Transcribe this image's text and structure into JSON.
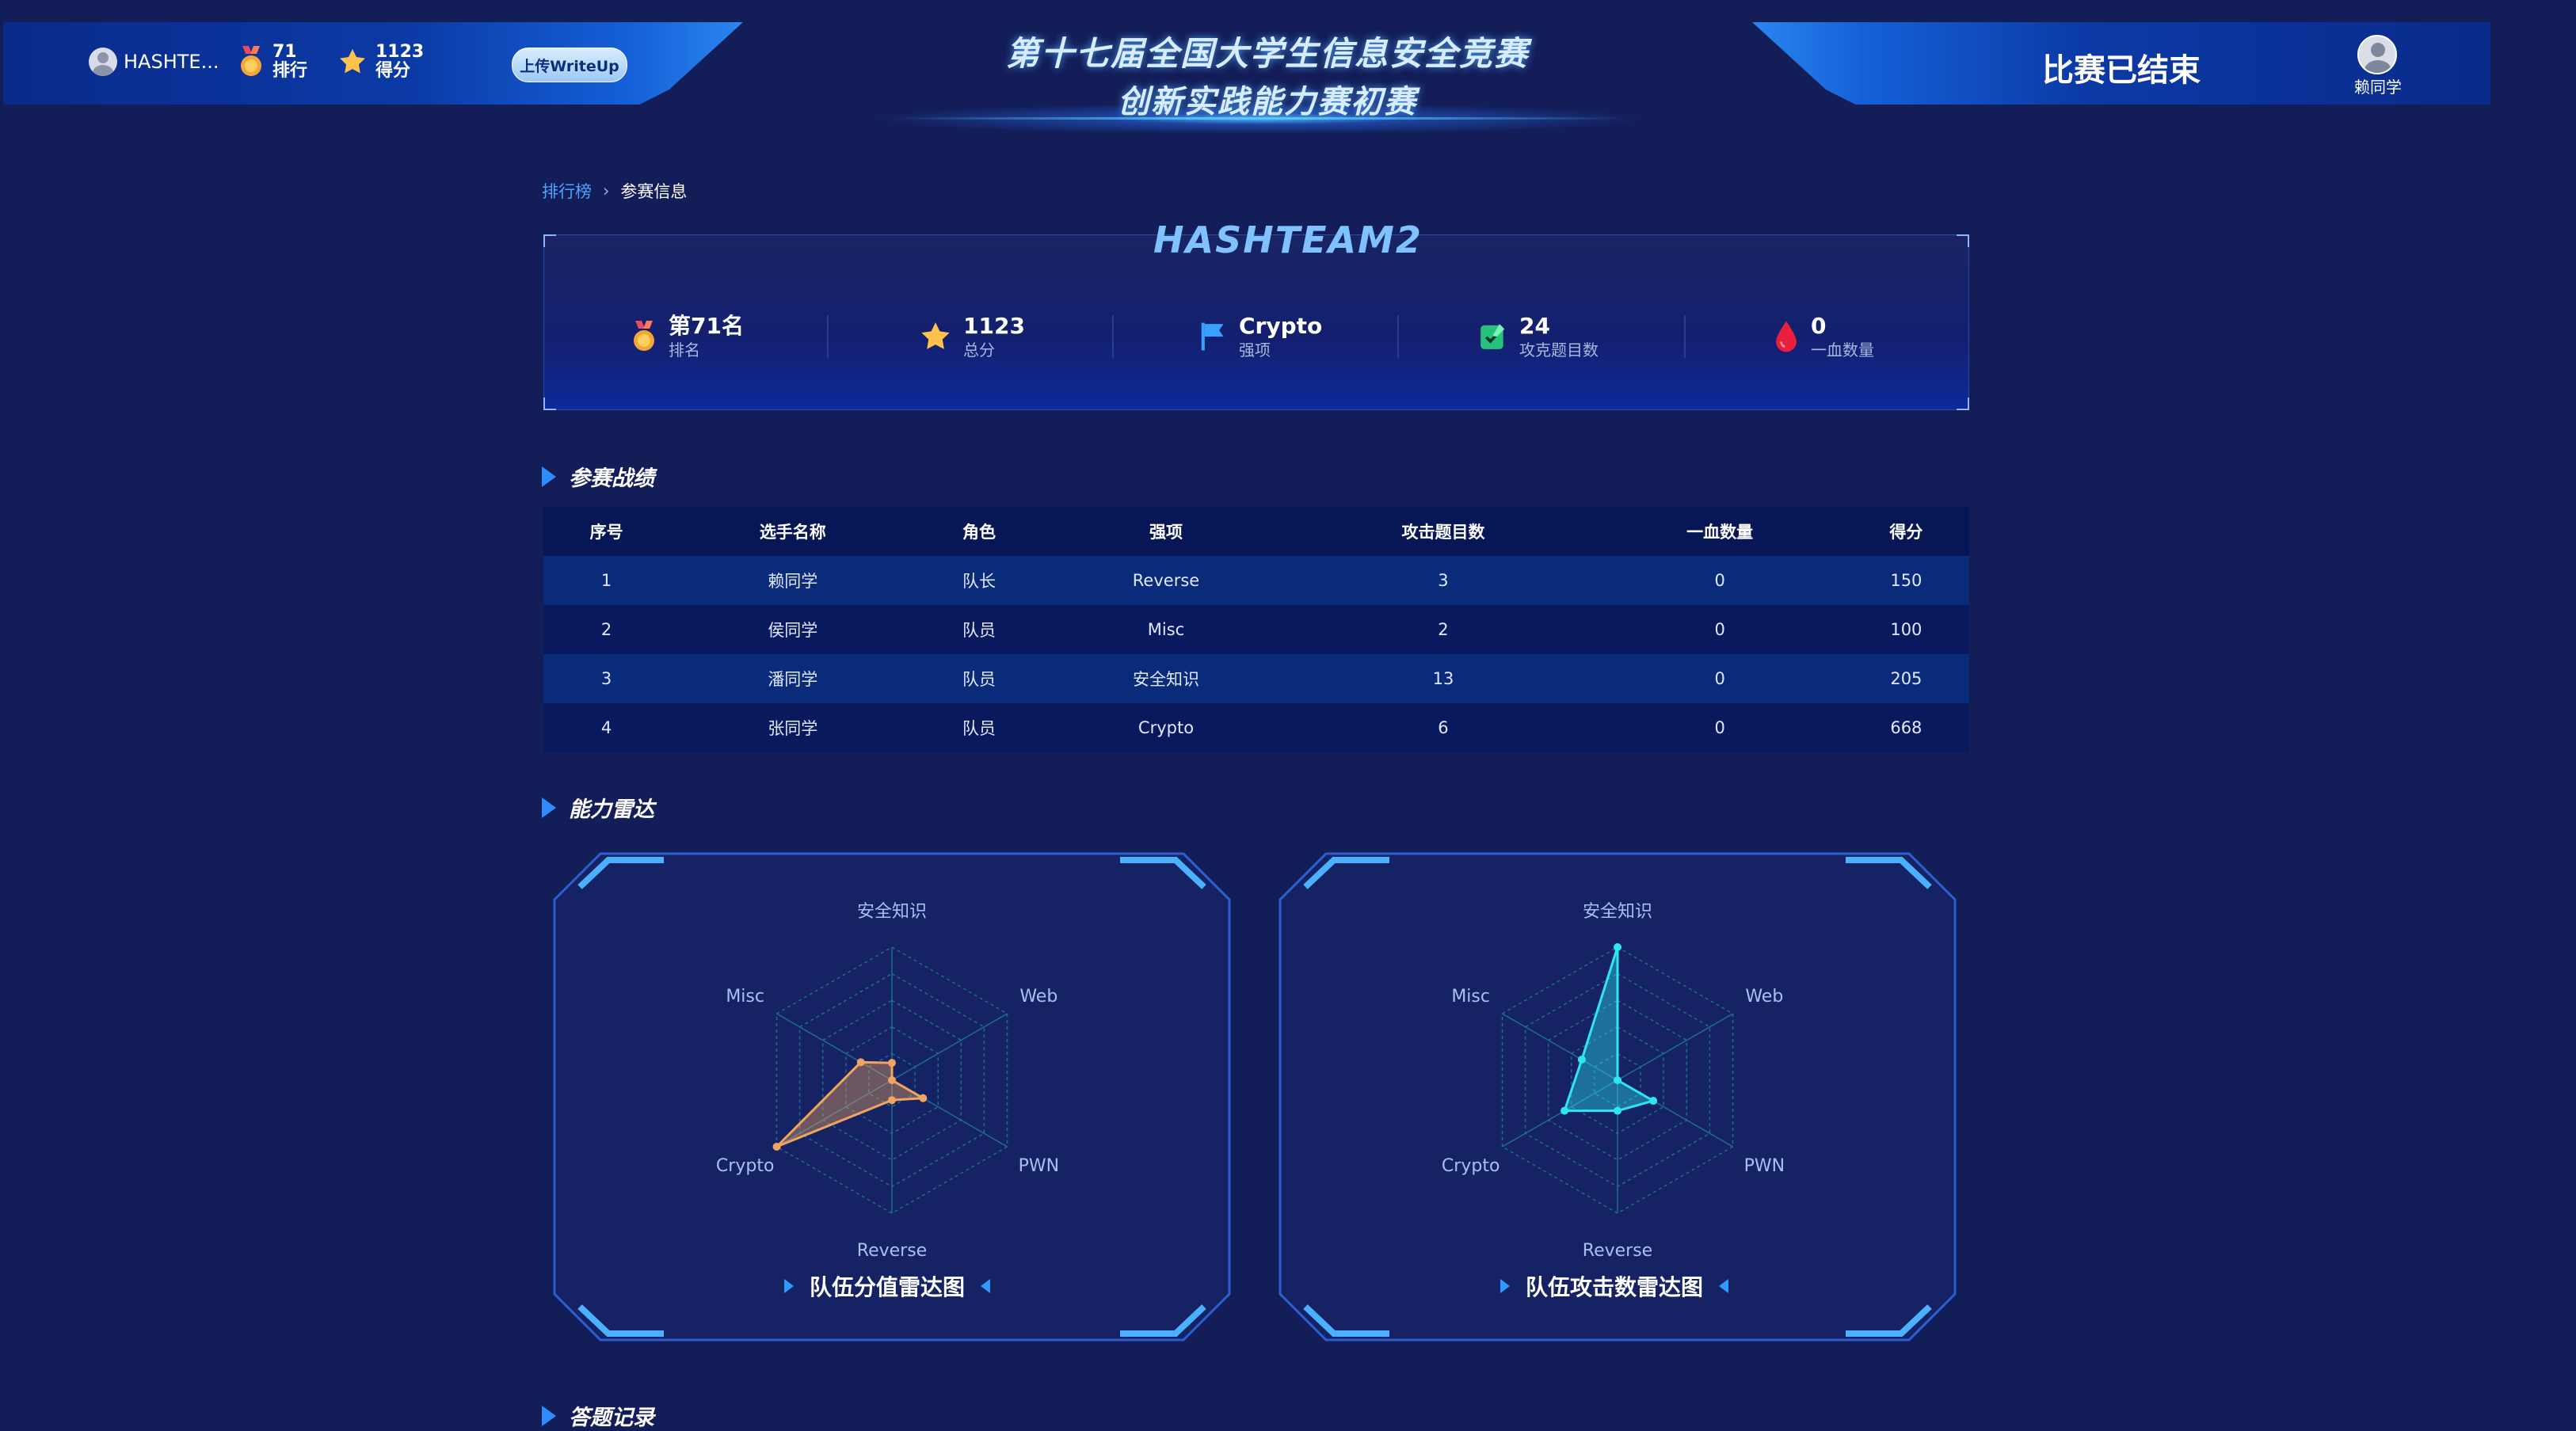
{
  "header": {
    "user_name": "HASHTE...",
    "rank_value": "71",
    "rank_label": "排行",
    "score_value": "1123",
    "score_label": "得分",
    "writeup_button": "上传WriteUp",
    "title_line1": "第十七届全国大学生信息安全竞赛",
    "title_line2": "创新实践能力赛初赛",
    "status": "比赛已结束",
    "current_user": "赖同学"
  },
  "breadcrumb": {
    "home": "排行榜",
    "current": "参赛信息"
  },
  "team": {
    "name": "HASHTEAM2",
    "stats": [
      {
        "value": "第71名",
        "label": "排名",
        "icon": "medal-icon"
      },
      {
        "value": "1123",
        "label": "总分",
        "icon": "star-icon"
      },
      {
        "value": "Crypto",
        "label": "强项",
        "icon": "flag-icon"
      },
      {
        "value": "24",
        "label": "攻克题目数",
        "icon": "check-icon"
      },
      {
        "value": "0",
        "label": "一血数量",
        "icon": "blood-drop-icon"
      }
    ]
  },
  "sections": {
    "record": "参赛战绩",
    "radar": "能力雷达",
    "answers": "答题记录"
  },
  "table": {
    "headers": [
      "序号",
      "选手名称",
      "角色",
      "强项",
      "攻击题目数",
      "一血数量",
      "得分"
    ],
    "rows": [
      [
        "1",
        "赖同学",
        "队长",
        "Reverse",
        "3",
        "0",
        "150"
      ],
      [
        "2",
        "侯同学",
        "队员",
        "Misc",
        "2",
        "0",
        "100"
      ],
      [
        "3",
        "潘同学",
        "队员",
        "安全知识",
        "13",
        "0",
        "205"
      ],
      [
        "4",
        "张同学",
        "队员",
        "Crypto",
        "6",
        "0",
        "668"
      ]
    ]
  },
  "chart_data": [
    {
      "type": "radar",
      "title": "队伍分值雷达图",
      "axes": [
        "安全知识",
        "Web",
        "PWN",
        "Reverse",
        "Crypto",
        "Misc"
      ],
      "values": [
        0.13,
        0.0,
        0.27,
        0.15,
        1.0,
        0.27
      ],
      "color": "#f0a460"
    },
    {
      "type": "radar",
      "title": "队伍攻击数雷达图",
      "axes": [
        "安全知识",
        "Web",
        "PWN",
        "Reverse",
        "Crypto",
        "Misc"
      ],
      "values": [
        1.0,
        0.0,
        0.31,
        0.23,
        0.46,
        0.31
      ],
      "color": "#2ee6f0"
    }
  ],
  "colors": {
    "background": "#131d57",
    "accent": "#2f8cff",
    "header": "#0b3aa6"
  }
}
